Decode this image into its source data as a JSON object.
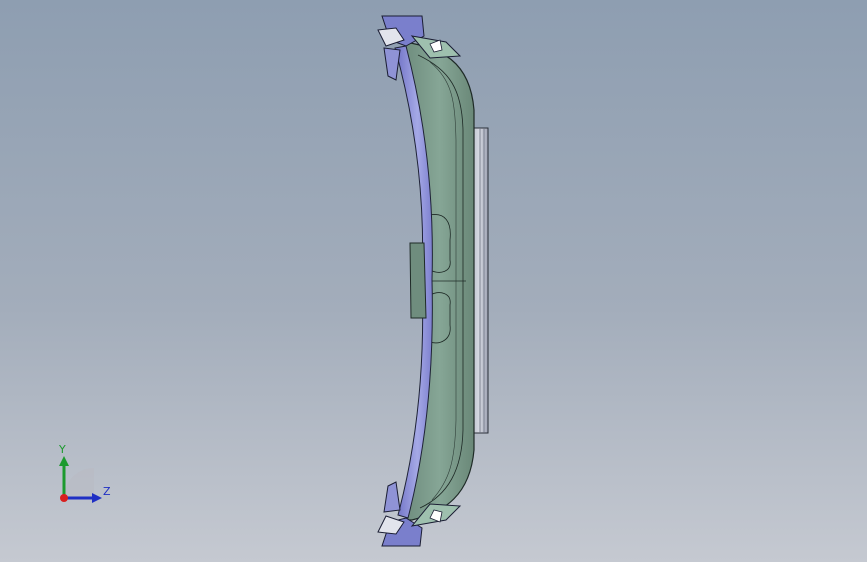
{
  "viewport": {
    "background_top": "#8e9eb1",
    "background_bottom": "#c5c9d1"
  },
  "model": {
    "face_color": "#7f9d8c",
    "edge_color": "#1e2a26",
    "flange_color": "#8f93d6",
    "plate_color": "#c8ccd6"
  },
  "triad": {
    "y_label": "Y",
    "z_label": "Z",
    "y_color": "#1c9a2e",
    "z_color": "#1f2fc4",
    "x_color": "#d81f1f"
  }
}
